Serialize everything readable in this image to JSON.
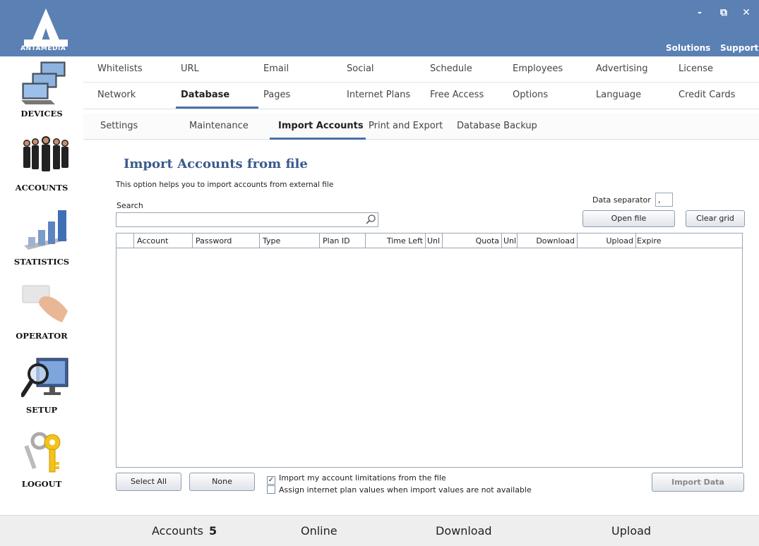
{
  "app": {
    "logo_text": "ANTAMEDIA"
  },
  "window_controls": {
    "minimize": "-",
    "restore": "⧉",
    "close": "✕"
  },
  "top_links": {
    "solutions": "Solutions",
    "support": "Support"
  },
  "sidebar": {
    "items": [
      {
        "label": "DEVICES",
        "icon": "computers-icon"
      },
      {
        "label": "ACCOUNTS",
        "icon": "people-icon"
      },
      {
        "label": "STATISTICS",
        "icon": "bar-chart-icon"
      },
      {
        "label": "OPERATOR",
        "icon": "card-hand-icon"
      },
      {
        "label": "SETUP",
        "icon": "monitor-magnifier-icon"
      },
      {
        "label": "LOGOUT",
        "icon": "keys-icon"
      }
    ]
  },
  "tabs": {
    "row1": [
      "Whitelists",
      "URL",
      "Email",
      "Social",
      "Schedule",
      "Employees",
      "Advertising",
      "License"
    ],
    "row2": [
      "Network",
      "Database",
      "Pages",
      "Internet Plans",
      "Free Access",
      "Options",
      "Language",
      "Credit Cards"
    ],
    "row2_active": "Database",
    "sub": [
      "Settings",
      "Maintenance",
      "Import Accounts",
      "Print and Export",
      "Database Backup"
    ],
    "sub_active": "Import Accounts"
  },
  "content": {
    "title": "Import Accounts from file",
    "description": "This option helps you to import accounts from external file",
    "search_label": "Search",
    "search_value": "",
    "separator_label": "Data separator",
    "separator_value": ",",
    "open_file": "Open file",
    "clear_grid": "Clear grid"
  },
  "grid": {
    "columns": [
      "Account",
      "Password",
      "Type",
      "Plan ID",
      "Time Left",
      "Unl",
      "Quota",
      "Unl",
      "Download",
      "Upload",
      "Expire"
    ],
    "rows": []
  },
  "actions": {
    "select_all": "Select All",
    "none": "None",
    "import_limitations_label": "Import my account limitations from the file",
    "import_limitations_checked": true,
    "assign_plan_label": "Assign internet plan values when import values are not available",
    "assign_plan_checked": false,
    "import_data": "Import Data"
  },
  "status": {
    "accounts_label": "Accounts",
    "accounts_value": "5",
    "online_label": "Online",
    "download_label": "Download",
    "upload_label": "Upload"
  },
  "colors": {
    "header": "#5a80b4",
    "title": "#3a5a8c",
    "accent": "#4a72ab"
  }
}
